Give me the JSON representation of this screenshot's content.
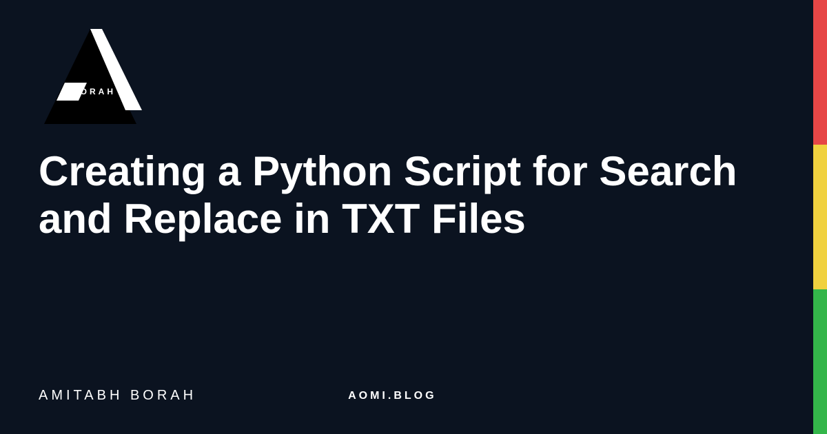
{
  "logo": {
    "wordmark": "BORAH"
  },
  "title": "Creating a Python Script for Search and Replace in TXT Files",
  "author": "AMITABH BORAH",
  "domain": "AOMI.BLOG",
  "stripes": [
    "#e64646",
    "#f0d13f",
    "#34b64a"
  ]
}
